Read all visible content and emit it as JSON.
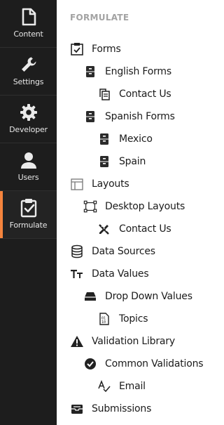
{
  "sections": [
    {
      "label": "Content",
      "icon": "document-icon"
    },
    {
      "label": "Settings",
      "icon": "wrench-icon"
    },
    {
      "label": "Developer",
      "icon": "gear-icon"
    },
    {
      "label": "Users",
      "icon": "user-icon"
    },
    {
      "label": "Formulate",
      "icon": "clipboard-check-icon",
      "active": true
    }
  ],
  "accent_color": "#f5843d",
  "tree": {
    "title": "FORMULATE",
    "nodes": [
      {
        "label": "Forms",
        "icon": "checkbox-icon"
      },
      {
        "label": "English Forms",
        "icon": "cabinet-icon"
      },
      {
        "label": "Contact Us",
        "icon": "form-copy-icon"
      },
      {
        "label": "Spanish Forms",
        "icon": "cabinet-icon"
      },
      {
        "label": "Mexico",
        "icon": "cabinet-icon"
      },
      {
        "label": "Spain",
        "icon": "cabinet-icon"
      },
      {
        "label": "Layouts",
        "icon": "layout-icon"
      },
      {
        "label": "Desktop Layouts",
        "icon": "vector-select-icon"
      },
      {
        "label": "Contact Us",
        "icon": "pencil-ruler-icon"
      },
      {
        "label": "Data Sources",
        "icon": "database-icon"
      },
      {
        "label": "Data Values",
        "icon": "text-size-icon"
      },
      {
        "label": "Drop Down Values",
        "icon": "drive-icon"
      },
      {
        "label": "Topics",
        "icon": "binary-file-icon"
      },
      {
        "label": "Validation Library",
        "icon": "warning-icon"
      },
      {
        "label": "Common Validations",
        "icon": "check-circle-icon"
      },
      {
        "label": "Email",
        "icon": "spellcheck-icon"
      },
      {
        "label": "Submissions",
        "icon": "inbox-icon"
      }
    ]
  }
}
